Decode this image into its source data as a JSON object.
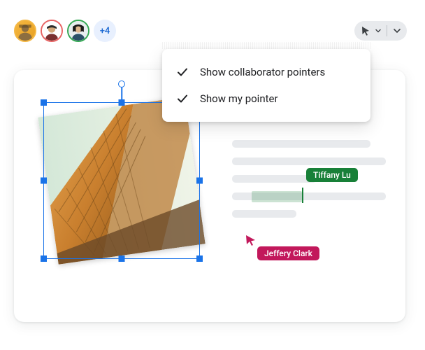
{
  "avatars": {
    "extra_count_label": "+4"
  },
  "toolbar": {
    "cursor_tool": "cursor"
  },
  "menu": {
    "show_collaborator_pointers": "Show collaborator pointers",
    "show_my_pointer": "Show my pointer"
  },
  "collaborators": {
    "tiffany": {
      "name": "Tiffany Lu",
      "color": "#188038"
    },
    "jeffery": {
      "name": "Jeffery Clark",
      "color": "#c2185b"
    }
  }
}
